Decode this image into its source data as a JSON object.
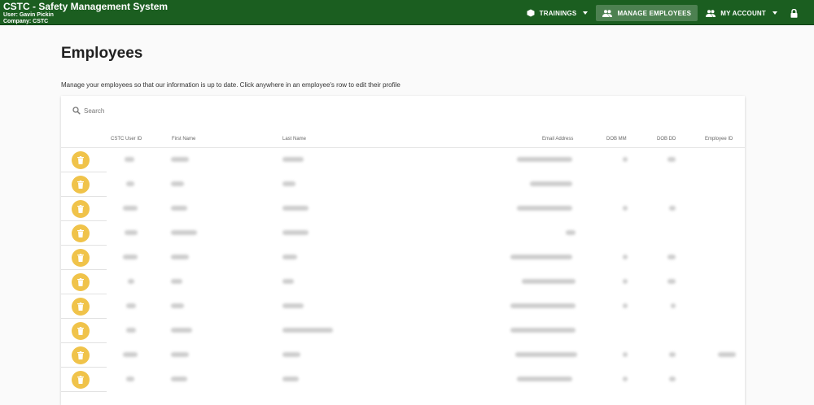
{
  "app": {
    "title": "CSTC - Safety Management System",
    "user_line": "User: Gavin Pickin",
    "company_line": "Company: CSTC"
  },
  "nav": {
    "trainings": "TRAININGS",
    "manage_employees": "MANAGE EMPLOYEES",
    "my_account": "MY ACCOUNT"
  },
  "page": {
    "title": "Employees",
    "intro": "Manage your employees so that our information is up to date. Click anywhere in an employee's row to edit their profile"
  },
  "search": {
    "placeholder": "Search"
  },
  "table": {
    "columns": [
      "CSTC User ID",
      "First Name",
      "Last Name",
      "Email Address",
      "DOB MM",
      "DOB DD",
      "Employee ID"
    ],
    "row_count": 10
  },
  "colors": {
    "header": "#1b5e20",
    "accent": "#f0c34a"
  }
}
